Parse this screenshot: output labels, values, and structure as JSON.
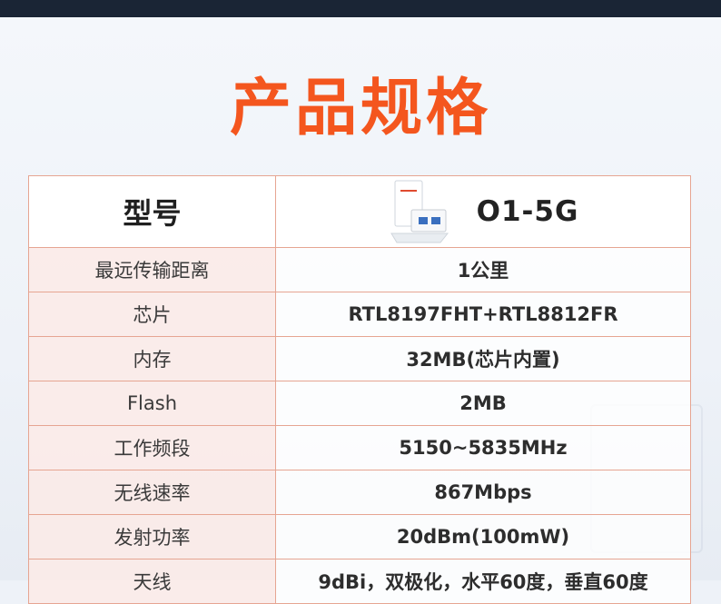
{
  "title": "产品规格",
  "table": {
    "header": {
      "label": "型号",
      "model": "O1-5G"
    },
    "rows": [
      {
        "label": "最远传输距离",
        "value": "1公里"
      },
      {
        "label": "芯片",
        "value": "RTL8197FHT+RTL8812FR"
      },
      {
        "label": "内存",
        "value": "32MB(芯片内置)"
      },
      {
        "label": "Flash",
        "value": "2MB"
      },
      {
        "label": "工作频段",
        "value": "5150~5835MHz"
      },
      {
        "label": "无线速率",
        "value": "867Mbps"
      },
      {
        "label": "发射功率",
        "value": "20dBm(100mW)"
      },
      {
        "label": "天线",
        "value": "9dBi，双极化，水平60度，垂直60度"
      }
    ]
  },
  "colors": {
    "title": "#f4561e",
    "border": "#e6a592",
    "label_bg": "#fceae6",
    "topbar": "#1a2535"
  }
}
